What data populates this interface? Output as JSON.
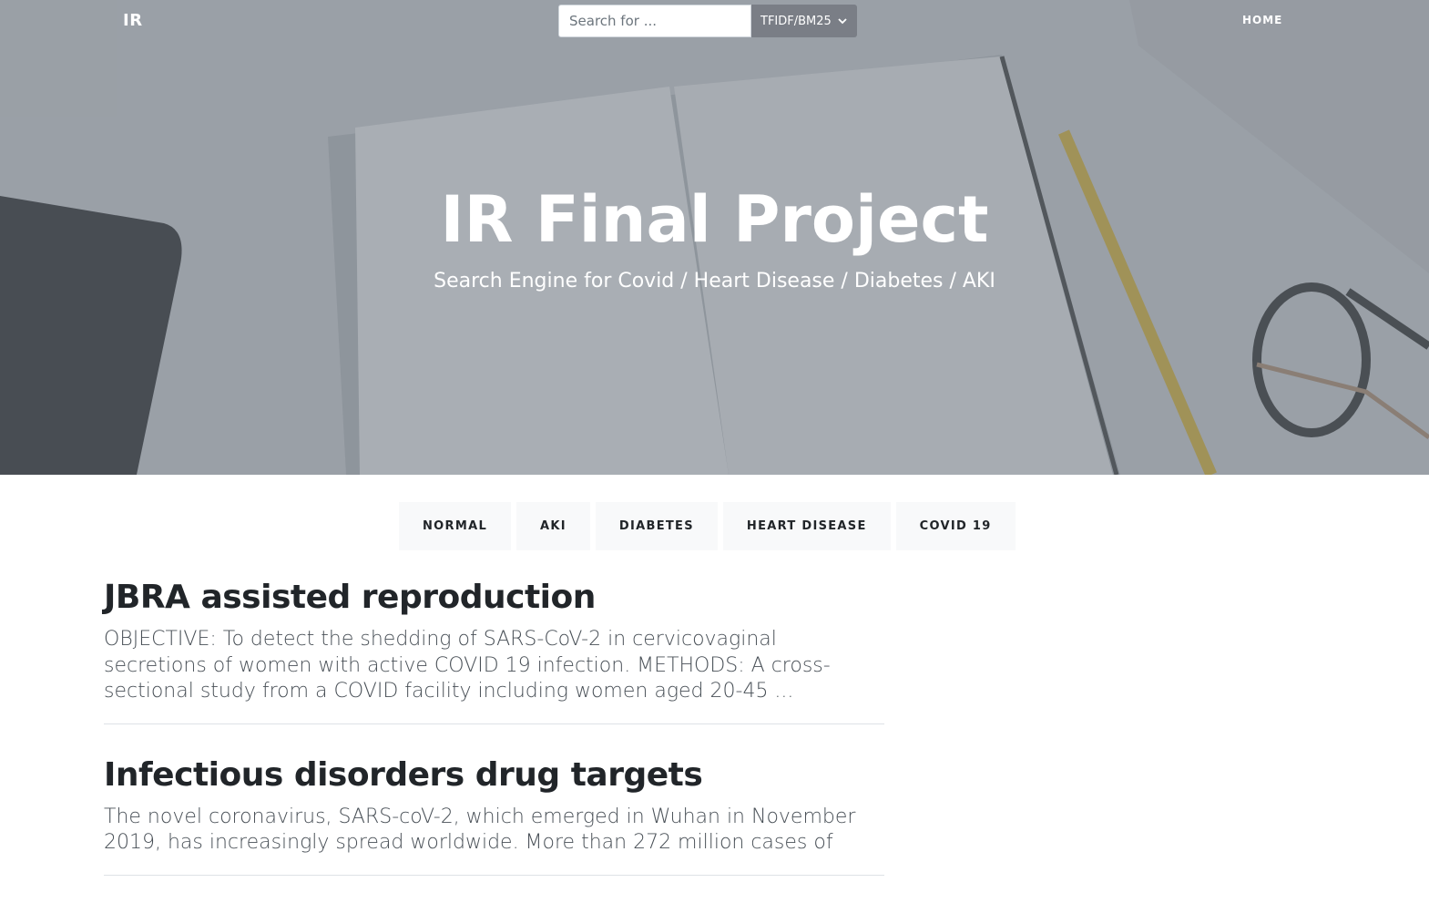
{
  "nav": {
    "brand": "IR",
    "search_placeholder": "Search for ...",
    "search_value": "",
    "model_select": "TFIDF/BM25",
    "home": "HOME"
  },
  "hero": {
    "title": "IR Final Project",
    "subtitle": "Search Engine for Covid / Heart Disease / Diabetes / AKI"
  },
  "filters": [
    "NORMAL",
    "AKI",
    "DIABETES",
    "HEART DISEASE",
    "COVID 19"
  ],
  "results": [
    {
      "title": "JBRA assisted reproduction",
      "abstract": "OBJECTIVE: To detect the shedding of SARS-CoV-2 in cervicovaginal secretions of women with active COVID 19 infection. METHODS: A cross-sectional study from a COVID facility including women aged 20-45 ..."
    },
    {
      "title": "Infectious disorders drug targets",
      "abstract": "The novel coronavirus, SARS-coV-2, which emerged in Wuhan in November 2019, has increasingly spread worldwide. More than 272 million cases of"
    }
  ],
  "colors": {
    "overlay": "#6c757d",
    "filter_bg": "#f8f9fa",
    "text_dark": "#212529",
    "text_muted": "#495057"
  }
}
